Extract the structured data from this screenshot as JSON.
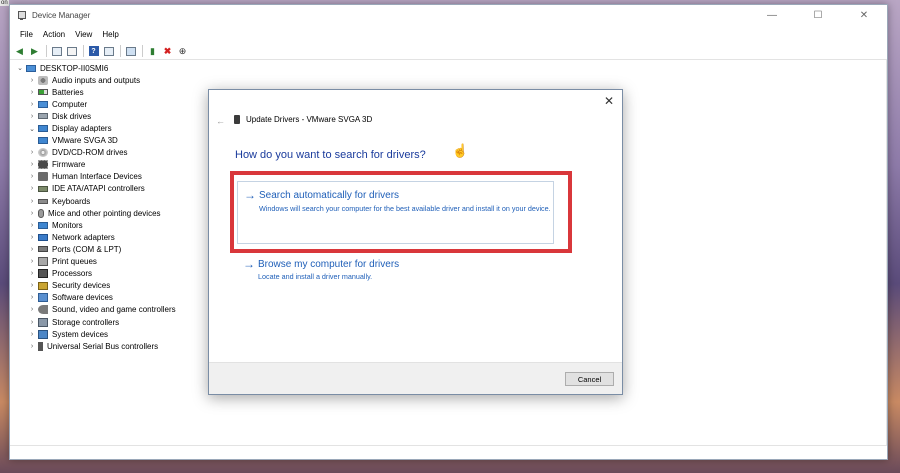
{
  "desktop": {
    "tag": "on"
  },
  "window": {
    "title": "Device Manager",
    "controls": {
      "minimize": "—",
      "maximize": "☐",
      "close": "✕"
    }
  },
  "menu": [
    "File",
    "Action",
    "View",
    "Help"
  ],
  "tree": {
    "root": "DESKTOP-II0SMI6",
    "items": [
      {
        "label": "Audio inputs and outputs",
        "icon": "speaker-icon"
      },
      {
        "label": "Batteries",
        "icon": "battery-icon"
      },
      {
        "label": "Computer",
        "icon": "computer-icon"
      },
      {
        "label": "Disk drives",
        "icon": "disk-icon"
      },
      {
        "label": "Display adapters",
        "icon": "monitor-icon",
        "expanded": true
      },
      {
        "label": "VMware SVGA 3D",
        "icon": "monitor-icon",
        "child": true
      },
      {
        "label": "DVD/CD-ROM drives",
        "icon": "dvd-icon"
      },
      {
        "label": "Firmware",
        "icon": "chip-icon"
      },
      {
        "label": "Human Interface Devices",
        "icon": "hid-icon"
      },
      {
        "label": "IDE ATA/ATAPI controllers",
        "icon": "ide-icon"
      },
      {
        "label": "Keyboards",
        "icon": "keyboard-icon"
      },
      {
        "label": "Mice and other pointing devices",
        "icon": "mouse-icon"
      },
      {
        "label": "Monitors",
        "icon": "monitor-icon"
      },
      {
        "label": "Network adapters",
        "icon": "network-icon"
      },
      {
        "label": "Ports (COM & LPT)",
        "icon": "port-icon"
      },
      {
        "label": "Print queues",
        "icon": "printer-icon"
      },
      {
        "label": "Processors",
        "icon": "cpu-icon"
      },
      {
        "label": "Security devices",
        "icon": "security-icon"
      },
      {
        "label": "Software devices",
        "icon": "software-icon"
      },
      {
        "label": "Sound, video and game controllers",
        "icon": "sound-icon"
      },
      {
        "label": "Storage controllers",
        "icon": "storage-icon"
      },
      {
        "label": "System devices",
        "icon": "system-icon"
      },
      {
        "label": "Universal Serial Bus controllers",
        "icon": "usb-icon"
      }
    ]
  },
  "dialog": {
    "header": "Update Drivers - VMware SVGA 3D",
    "question": "How do you want to search for drivers?",
    "option1": {
      "title": "Search automatically for drivers",
      "desc": "Windows will search your computer for the best available driver and install it on your device."
    },
    "option2": {
      "title": "Browse my computer for drivers",
      "desc": "Locate and install a driver manually."
    },
    "cancel": "Cancel",
    "highlight_color": "#d9373b"
  }
}
